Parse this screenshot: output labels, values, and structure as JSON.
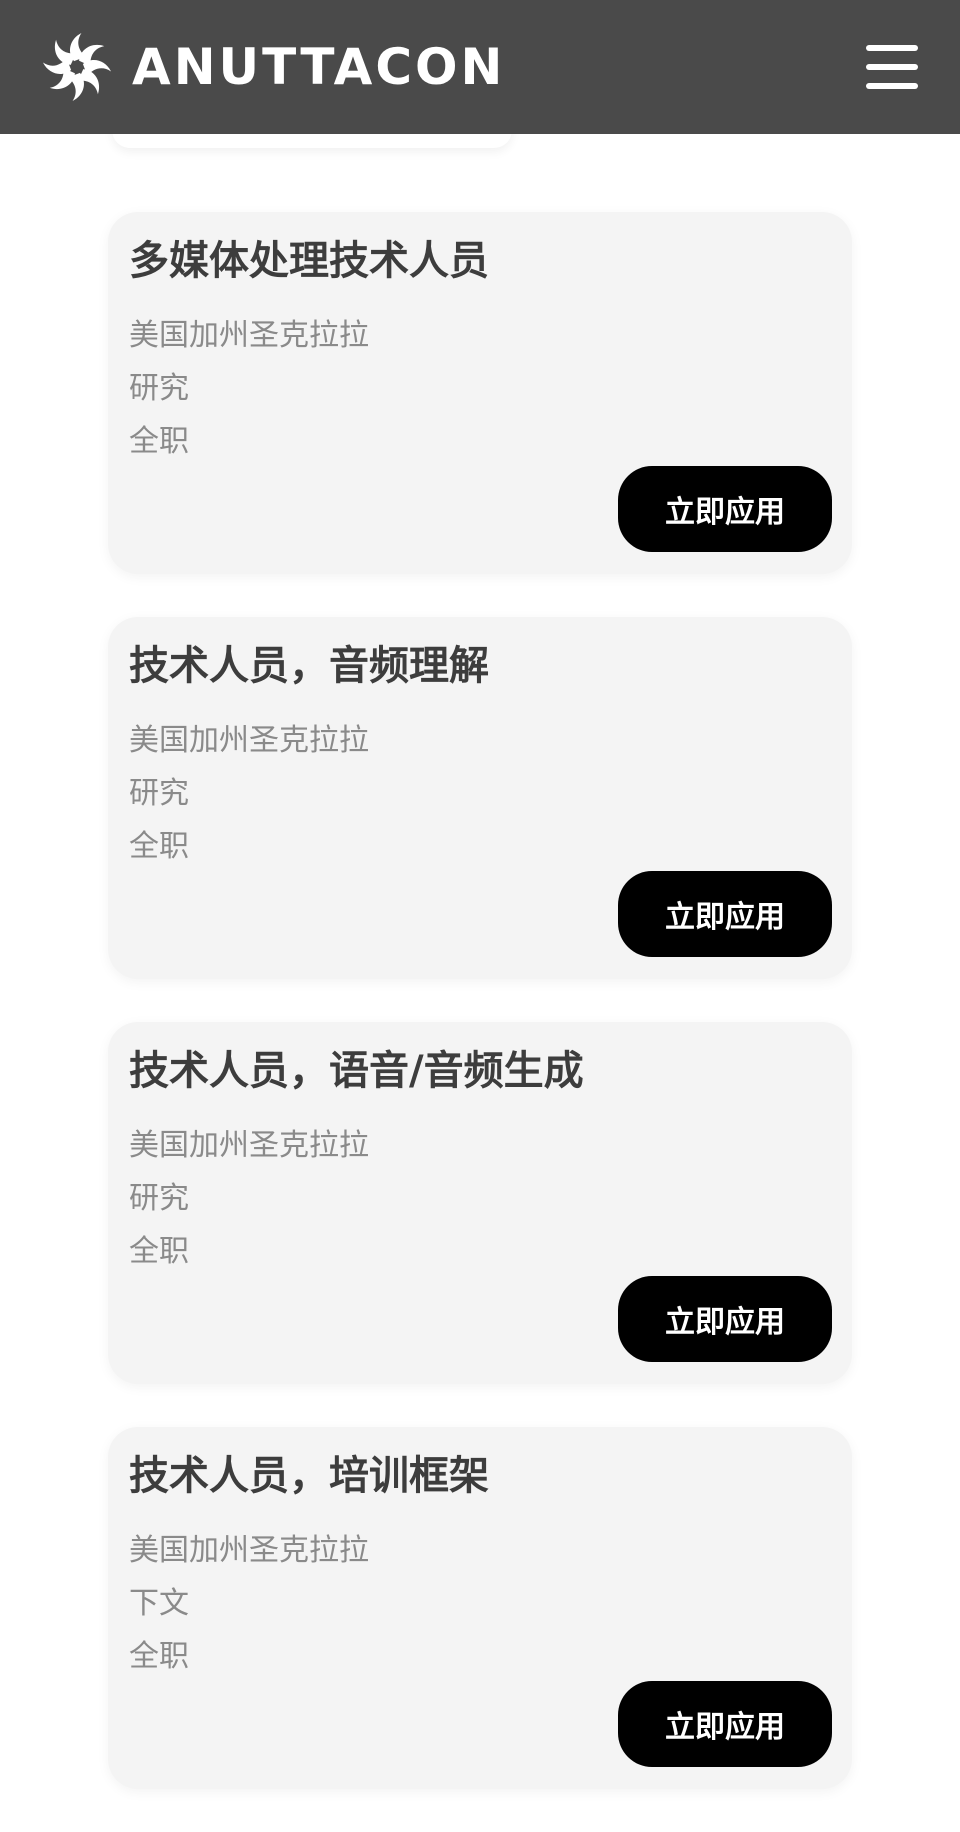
{
  "header": {
    "brand_name": "ANUTTACON",
    "logo_icon": "pinwheel-logo-icon",
    "menu_icon": "hamburger-menu-icon",
    "background_color": "#4a4a4a"
  },
  "jobs": [
    {
      "title": "多媒体处理技术人员",
      "location": "美国加州圣克拉拉",
      "team": "研究",
      "type": "全职",
      "apply_label": "立即应用"
    },
    {
      "title": "技术人员，音频理解",
      "location": "美国加州圣克拉拉",
      "team": "研究",
      "type": "全职",
      "apply_label": "立即应用"
    },
    {
      "title": "技术人员，语音/音频生成",
      "location": "美国加州圣克拉拉",
      "team": "研究",
      "type": "全职",
      "apply_label": "立即应用"
    },
    {
      "title": "技术人员，培训框架",
      "location": "美国加州圣克拉拉",
      "team": "下文",
      "type": "全职",
      "apply_label": "立即应用"
    }
  ]
}
